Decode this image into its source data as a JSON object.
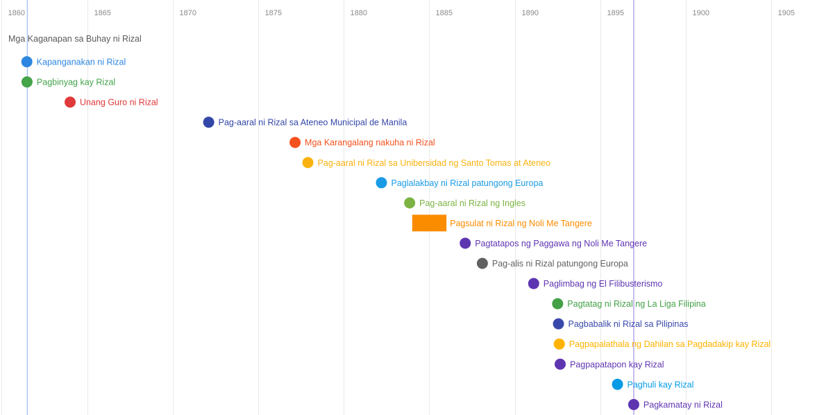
{
  "chart_data": {
    "type": "timeline",
    "title": "Mga Kaganapan sa Buhay ni Rizal",
    "x_ticks": [
      1860,
      1865,
      1870,
      1875,
      1880,
      1885,
      1890,
      1895,
      1900,
      1905
    ],
    "xlim": [
      1859.9,
      1908.6
    ],
    "grid": true,
    "markers": [
      {
        "year": 1861.5,
        "color": "#a7c4f5"
      },
      {
        "year": 1896.95,
        "color": "#b7a6ea"
      }
    ],
    "events": [
      {
        "label": "Kapanganakan ni Rizal",
        "date": "1861-06-19",
        "start": 1861.47,
        "color": "#2d86e0"
      },
      {
        "label": "Pagbinyag kay Rizal",
        "date": "1861-06-22",
        "start": 1861.48,
        "color": "#45a34a"
      },
      {
        "label": "Unang Guro ni Rizal",
        "date": "1864",
        "start": 1864.0,
        "color": "#e03a3a"
      },
      {
        "label": "Pag-aaral ni Rizal sa Ateneo Municipal de Manila",
        "date": "1872",
        "start": 1872.1,
        "color": "#3347a8"
      },
      {
        "label": "Mga Karangalang nakuha ni Rizal",
        "date": "1877",
        "start": 1877.15,
        "color": "#f4511e"
      },
      {
        "label": "Pag-aaral ni Rizal sa Unibersidad ng Santo Tomas at Ateneo",
        "date": "1877/1878",
        "start": 1877.9,
        "color": "#f9b20f"
      },
      {
        "label": "Paglalakbay ni Rizal patungong Europa",
        "date": "1882",
        "start": 1882.2,
        "color": "#1a9be6"
      },
      {
        "label": "Pag-aaral ni Rizal ng Ingles",
        "date": "1884",
        "start": 1883.85,
        "color": "#7cb342"
      },
      {
        "label": "Pagsulat ni Rizal ng Noli Me Tangere",
        "date": "1884–1886",
        "start": 1884.0,
        "end": 1886.0,
        "color": "#fb8c00"
      },
      {
        "label": "Pagtatapos ng Paggawa ng Noli Me Tangere",
        "date": "1887",
        "start": 1887.1,
        "color": "#5e35b1"
      },
      {
        "label": "Pag-alis ni Rizal patungong Europa",
        "date": "1888",
        "start": 1888.1,
        "color": "#616161"
      },
      {
        "label": "Paglimbag ng El Filibusterismo",
        "date": "1891",
        "start": 1891.1,
        "color": "#5e35b1"
      },
      {
        "label": "Pagtatag ni Rizal ng La Liga Filipina",
        "date": "1892",
        "start": 1892.5,
        "color": "#43a047"
      },
      {
        "label": "Pagbabalik ni Rizal sa Pilipinas",
        "date": "1892",
        "start": 1892.55,
        "color": "#3949ab"
      },
      {
        "label": "Pagpapalathala ng Dahilan sa Pagdadakip kay Rizal",
        "date": "1892",
        "start": 1892.6,
        "color": "#ffb300"
      },
      {
        "label": "Pagpapatapon kay Rizal",
        "date": "1892",
        "start": 1892.65,
        "color": "#5e35b1"
      },
      {
        "label": "Paghuli kay Rizal",
        "date": "1896",
        "start": 1896.0,
        "color": "#039be5"
      },
      {
        "label": "Pagkamatay ni Rizal",
        "date": "1896-12-30",
        "start": 1896.95,
        "color": "#5e35b1"
      }
    ]
  }
}
